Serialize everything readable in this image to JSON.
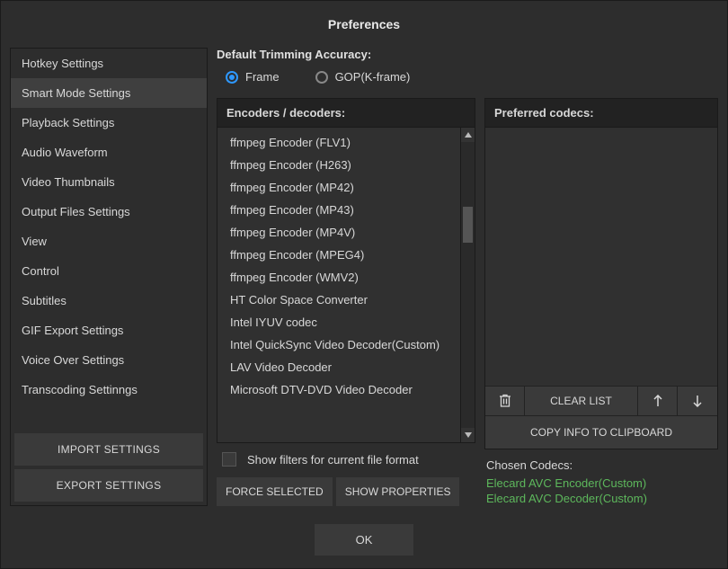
{
  "window": {
    "title": "Preferences"
  },
  "sidebar": {
    "items": [
      {
        "label": "Hotkey Settings",
        "active": false
      },
      {
        "label": "Smart Mode Settings",
        "active": true
      },
      {
        "label": "Playback Settings",
        "active": false
      },
      {
        "label": "Audio Waveform",
        "active": false
      },
      {
        "label": "Video Thumbnails",
        "active": false
      },
      {
        "label": "Output Files Settings",
        "active": false
      },
      {
        "label": "View",
        "active": false
      },
      {
        "label": "Control",
        "active": false
      },
      {
        "label": "Subtitles",
        "active": false
      },
      {
        "label": "GIF Export Settings",
        "active": false
      },
      {
        "label": "Voice Over Settings",
        "active": false
      },
      {
        "label": "Transcoding Settinngs",
        "active": false
      }
    ],
    "import_btn": "IMPORT SETTINGS",
    "export_btn": "EXPORT SETTINGS"
  },
  "main": {
    "trim_label": "Default Trimming Accuracy:",
    "radio_frame": "Frame",
    "radio_gop": "GOP(K-frame)",
    "radio_selected": "frame",
    "encoders_header": "Encoders / decoders:",
    "encoders": [
      "ffmpeg Encoder (FLV1)",
      "ffmpeg Encoder (H263)",
      "ffmpeg Encoder (MP42)",
      "ffmpeg Encoder (MP43)",
      "ffmpeg Encoder (MP4V)",
      "ffmpeg Encoder (MPEG4)",
      "ffmpeg Encoder (WMV2)",
      "HT Color Space Converter",
      "Intel IYUV codec",
      "Intel QuickSync Video Decoder(Custom)",
      "LAV Video Decoder",
      "Microsoft DTV-DVD Video Decoder"
    ],
    "show_filters_label": "Show filters for current file format",
    "force_selected_btn": "FORCE SELECTED",
    "show_props_btn": "SHOW PROPERTIES",
    "preferred_header": "Preferred codecs:",
    "clear_list_btn": "CLEAR LIST",
    "copy_info_btn": "COPY INFO TO CLIPBOARD",
    "chosen_label": "Chosen Codecs:",
    "chosen_codecs": [
      "Elecard AVC Encoder(Custom)",
      "Elecard AVC Decoder(Custom)"
    ]
  },
  "footer": {
    "ok": "OK"
  }
}
